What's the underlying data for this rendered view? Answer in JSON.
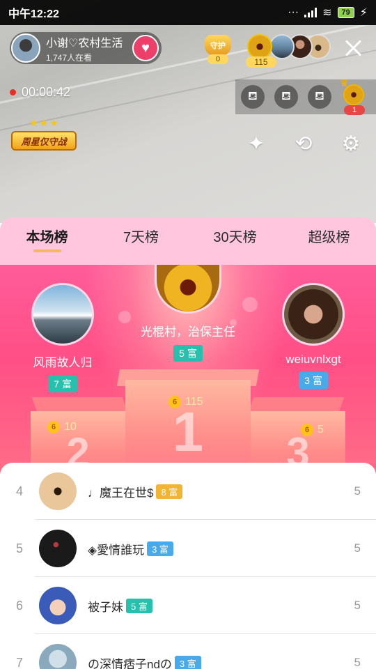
{
  "status_bar": {
    "time": "中午12:22",
    "battery": "79"
  },
  "anchor": {
    "name": "小谢♡农村生活",
    "viewers": "1,747人在看",
    "follow_icon": "heart-plus"
  },
  "guard": {
    "label": "守护",
    "count": "0"
  },
  "top_viewers": {
    "count": "115"
  },
  "live": {
    "timer": "00:00:42"
  },
  "seats": {
    "king_badge": "1"
  },
  "weekly_badge": {
    "text": "周星仅守战"
  },
  "tools": {
    "beauty_icon": "magic-wand",
    "flip_icon": "camera-flip",
    "settings_icon": "gear"
  },
  "tabs": [
    {
      "label": "本场榜",
      "active": true
    },
    {
      "label": "7天榜",
      "active": false
    },
    {
      "label": "30天榜",
      "active": false
    },
    {
      "label": "超级榜",
      "active": false
    }
  ],
  "podium": {
    "first": {
      "name": "光棍村，治保主任",
      "rich": "5 富",
      "score": "115",
      "rank_number": "1"
    },
    "second": {
      "name": "风雨故人归",
      "rich": "7 富",
      "score": "10",
      "rank_number": "2"
    },
    "third": {
      "name": "weiuvnlxgt",
      "rich": "3 富",
      "score": "5",
      "rank_number": "3"
    }
  },
  "list": [
    {
      "rank": "4",
      "name": "♩魔王在世$",
      "rich": "8 富",
      "rich_color": "gold",
      "score": "5"
    },
    {
      "rank": "5",
      "name": "◈愛情誰玩",
      "rich": "3 富",
      "rich_color": "blue",
      "score": "5"
    },
    {
      "rank": "6",
      "name": "被子妹",
      "rich": "5 富",
      "rich_color": "teal",
      "score": "5"
    },
    {
      "rank": "7",
      "name": "の深情痞子ndの",
      "rich": "3 富",
      "rich_color": "blue",
      "score": "5"
    }
  ],
  "colors": {
    "podium_top": "#ff5c9a",
    "tabs_bg": "#ffc6dd",
    "rich_teal": "#27c0ad",
    "rich_blue": "#4aa9e8",
    "rich_gold": "#f1b533"
  }
}
